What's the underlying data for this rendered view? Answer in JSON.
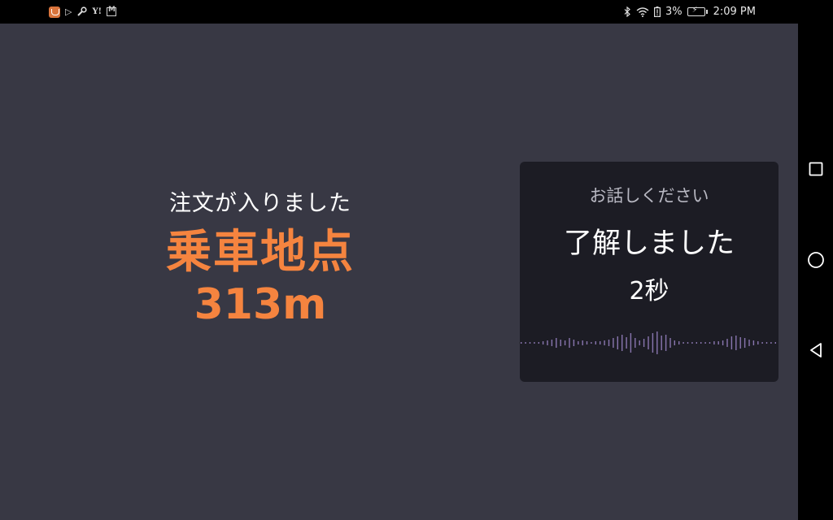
{
  "status_bar": {
    "left_icons": [
      "app-notification-icon",
      "play-store-icon",
      "wrench-icon",
      "yahoo-icon",
      "gmail-icon"
    ],
    "right_icons": [
      "bluetooth-icon",
      "wifi-icon",
      "battery-alert-icon"
    ],
    "battery_percent": "3%",
    "time": "2:09 PM"
  },
  "main": {
    "order_message": "注文が入りました",
    "pickup_label": "乗車地点",
    "pickup_distance": "313m"
  },
  "voice_panel": {
    "prompt": "お話しください",
    "response": "了解しました",
    "countdown": "2秒"
  },
  "nav_bar": {
    "buttons": [
      "recents-button",
      "home-button",
      "back-button"
    ]
  },
  "colors": {
    "background": "#383844",
    "accent_orange": "#f5843f",
    "panel_background": "#1c1c24",
    "wave_color": "#9c86c8"
  }
}
